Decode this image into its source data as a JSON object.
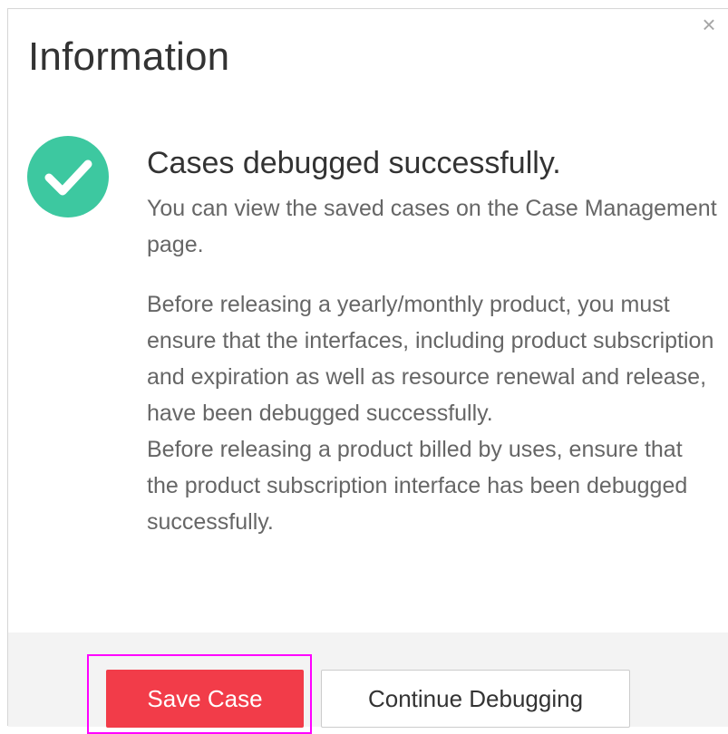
{
  "dialog": {
    "title": "Information",
    "close_symbol": "×",
    "icon": "check-circle-icon",
    "headline": "Cases debugged successfully.",
    "paragraph_1": "You can view the saved cases on the Case Management page.",
    "paragraph_2_line_1": "Before releasing a yearly/monthly product, you must ensure that the interfaces, including product subscription and expiration as well as resource renewal and release, have been debugged successfully.",
    "paragraph_2_line_2": "Before releasing a product billed by uses, ensure that the product subscription interface has been debugged successfully."
  },
  "buttons": {
    "save_label": "Save Case",
    "continue_label": "Continue Debugging"
  },
  "colors": {
    "success": "#3dc8a0",
    "primary": "#f23c49",
    "highlight": "#ff00ff"
  }
}
